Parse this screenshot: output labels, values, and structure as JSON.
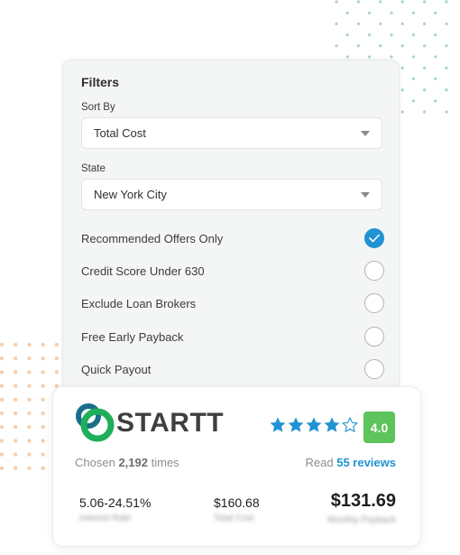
{
  "filters": {
    "title": "Filters",
    "sort_by": {
      "label": "Sort By",
      "value": "Total Cost"
    },
    "state": {
      "label": "State",
      "value": "New York City"
    },
    "options": [
      {
        "label": "Recommended Offers Only",
        "checked": true
      },
      {
        "label": "Credit Score Under 630",
        "checked": false
      },
      {
        "label": "Exclude Loan Brokers",
        "checked": false
      },
      {
        "label": "Free Early Payback",
        "checked": false
      },
      {
        "label": "Quick Payout",
        "checked": false
      }
    ]
  },
  "offer": {
    "brand": "STARTT",
    "rating": {
      "value": "4.0",
      "stars_filled": 4,
      "stars_total": 5
    },
    "chosen_prefix": "Chosen",
    "chosen_count": "2,192",
    "chosen_suffix": "times",
    "reviews_prefix": "Read",
    "reviews_link": "55 reviews",
    "stats": [
      {
        "value": "5.06-24.51%",
        "label": "Interest Rate"
      },
      {
        "value": "$160.68",
        "label": "Total Cost"
      },
      {
        "value": "$131.69",
        "label": "Monthly Payback"
      }
    ]
  },
  "colors": {
    "accent_blue": "#2193d2",
    "rating_green": "#5cc45a",
    "logo_teal": "#1a6e8a",
    "logo_green": "#1fae5a",
    "dots_teal": "#a9d3c8",
    "dots_orange": "#f5cfae"
  }
}
